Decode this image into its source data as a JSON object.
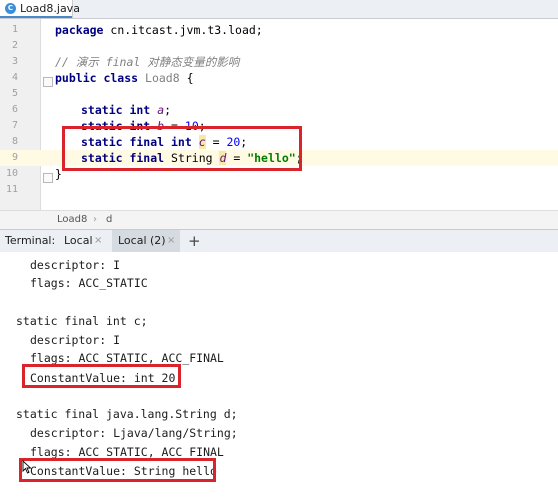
{
  "editor": {
    "tab_icon": "C",
    "tab_label": "Load8.java",
    "lines": [
      {
        "n": "1"
      },
      {
        "n": "2"
      },
      {
        "n": "3"
      },
      {
        "n": "4"
      },
      {
        "n": "5"
      },
      {
        "n": "6"
      },
      {
        "n": "7"
      },
      {
        "n": "8"
      },
      {
        "n": "9"
      },
      {
        "n": "10"
      },
      {
        "n": "11"
      }
    ],
    "code": {
      "kw_package": "package",
      "package_name": " cn.itcast.jvm.t3.load;",
      "comment": "// 演示 final 对静态变量的影响",
      "kw_public_class": "public class",
      "class_name": " Load8",
      "brace_open": " {",
      "kw_static_int": "static int",
      "field_a": "a",
      "semicolon": ";",
      "field_b": "b",
      "assign": " = ",
      "val_10": "10",
      "kw_static_final_int": "static final int",
      "field_c": "c",
      "val_20": "20",
      "kw_static_final": "static final",
      "type_string": " String ",
      "field_d": "d",
      "val_hello": "\"hello\"",
      "brace_close": "}"
    }
  },
  "breadcrumb": {
    "item1": "Load8",
    "sep": "›",
    "item2": "d"
  },
  "terminal": {
    "label": "Terminal:",
    "tabs": [
      {
        "label": "Local",
        "close": "×"
      },
      {
        "label": "Local (2)",
        "close": "×"
      }
    ],
    "add": "+",
    "output": [
      "descriptor: I",
      "flags: ACC_STATIC",
      "static final int c;",
      "descriptor: I",
      "flags: ACC_STATIC, ACC_FINAL",
      "ConstantValue: int 20",
      "static final java.lang.String d;",
      "descriptor: Ljava/lang/String;",
      "flags: ACC_STATIC, ACC_FINAL",
      "ConstantValue: String hello"
    ]
  },
  "colors": {
    "highlight_box": "#d9242c",
    "current_line": "#fffae3",
    "keyword": "#000080",
    "string": "#008000",
    "number": "#0000ff"
  }
}
